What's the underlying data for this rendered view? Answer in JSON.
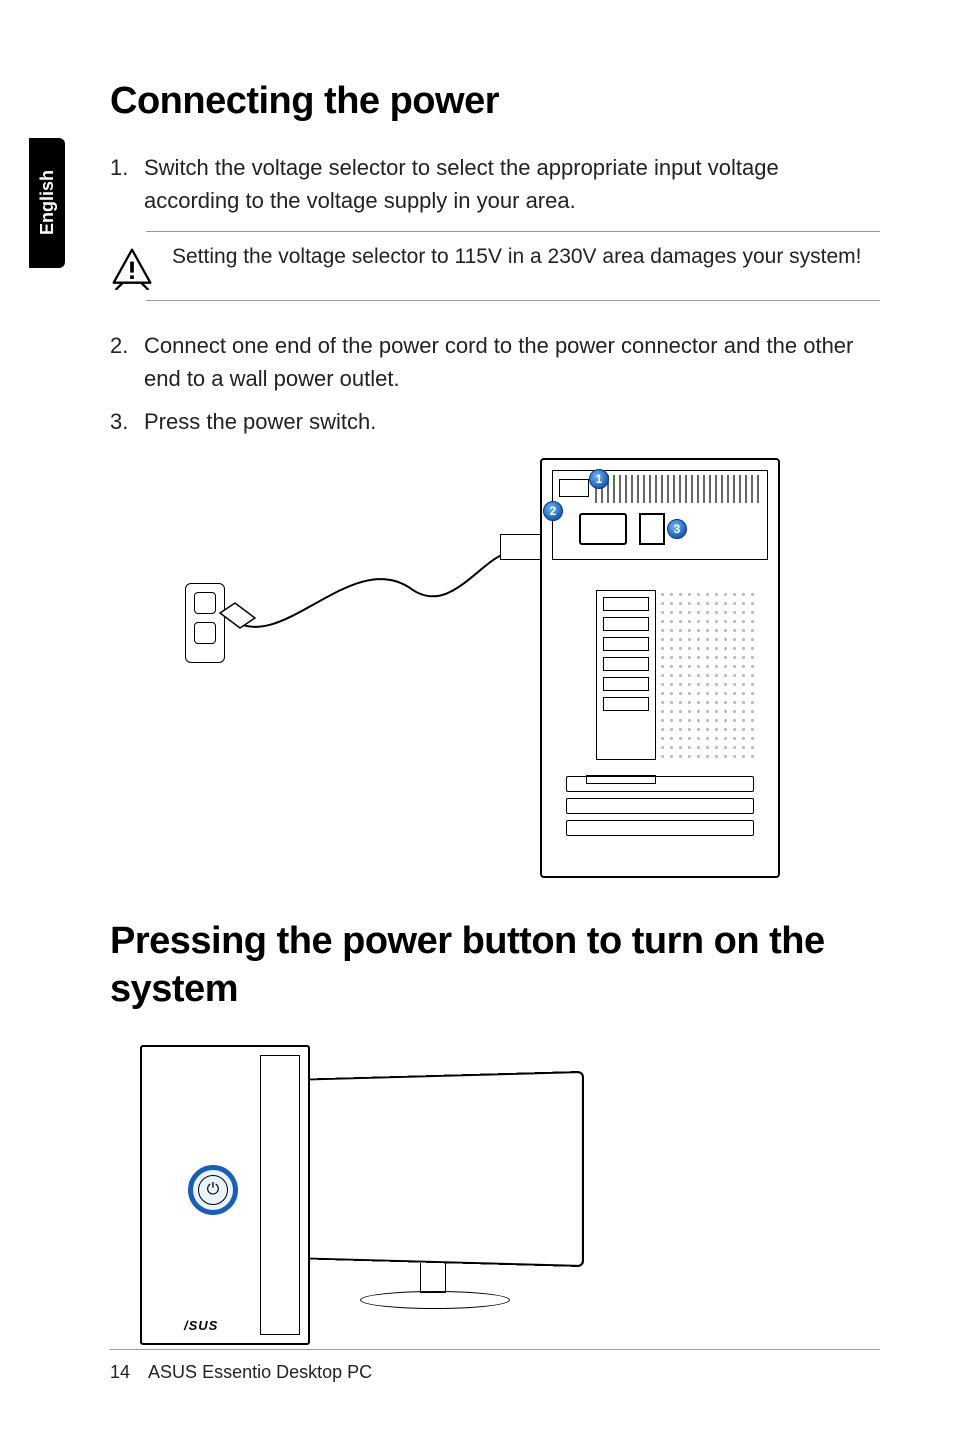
{
  "language_tab": "English",
  "heading1": "Connecting the power",
  "steps_part1": [
    {
      "num": "1.",
      "text": "Switch the voltage selector to select the appropriate input voltage according to the voltage supply in your area."
    }
  ],
  "warning": "Setting the voltage selector to 115V in a 230V area damages your system!",
  "steps_part2": [
    {
      "num": "2.",
      "text": "Connect one end of the power cord to the power connector and the other end to a wall power outlet."
    },
    {
      "num": "3.",
      "text": "Press the power switch."
    }
  ],
  "callouts": {
    "c1": "1",
    "c2": "2",
    "c3": "3"
  },
  "heading2": "Pressing the power button to turn on the system",
  "footer": {
    "page": "14",
    "product": "ASUS Essentio Desktop PC"
  }
}
